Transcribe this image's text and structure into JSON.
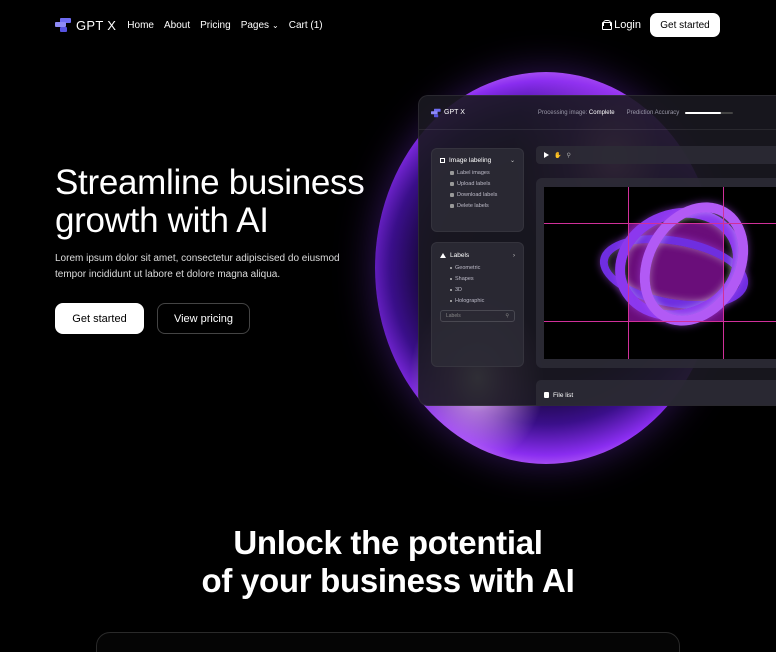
{
  "nav": {
    "brand": "GPT X",
    "links": [
      "Home",
      "About",
      "Pricing",
      "Pages",
      "Cart (1)"
    ],
    "login": "Login",
    "cta": "Get started"
  },
  "hero": {
    "title_line1": "Streamline business",
    "title_line2": "growth with AI",
    "subtitle": "Lorem ipsum dolor sit amet, consectetur adipiscised do eiusmod tempor incididunt ut labore et dolore magna aliqua.",
    "primary_btn": "Get started",
    "secondary_btn": "View pricing"
  },
  "panel": {
    "brand": "GPT X",
    "status_label": "Processing image:",
    "status_value": "Complete",
    "accuracy_label": "Prediction Accuracy",
    "accuracy": 0.75,
    "image_labeling": {
      "title": "Image labeling",
      "items": [
        "Label images",
        "Upload labels",
        "Download labels",
        "Delete labels"
      ]
    },
    "labels": {
      "title": "Labels",
      "items": [
        "Geometric",
        "Shapes",
        "3D",
        "Holographic"
      ],
      "search_placeholder": "Labels"
    },
    "file_list": "File list"
  },
  "section2": {
    "title_line1": "Unlock the potential",
    "title_line2": "of your business with AI"
  },
  "colors": {
    "background": "#000000",
    "accent_purple": "#8a2df0",
    "guide_line": "#d0309a",
    "brand_logo": "#6f6cf2"
  }
}
